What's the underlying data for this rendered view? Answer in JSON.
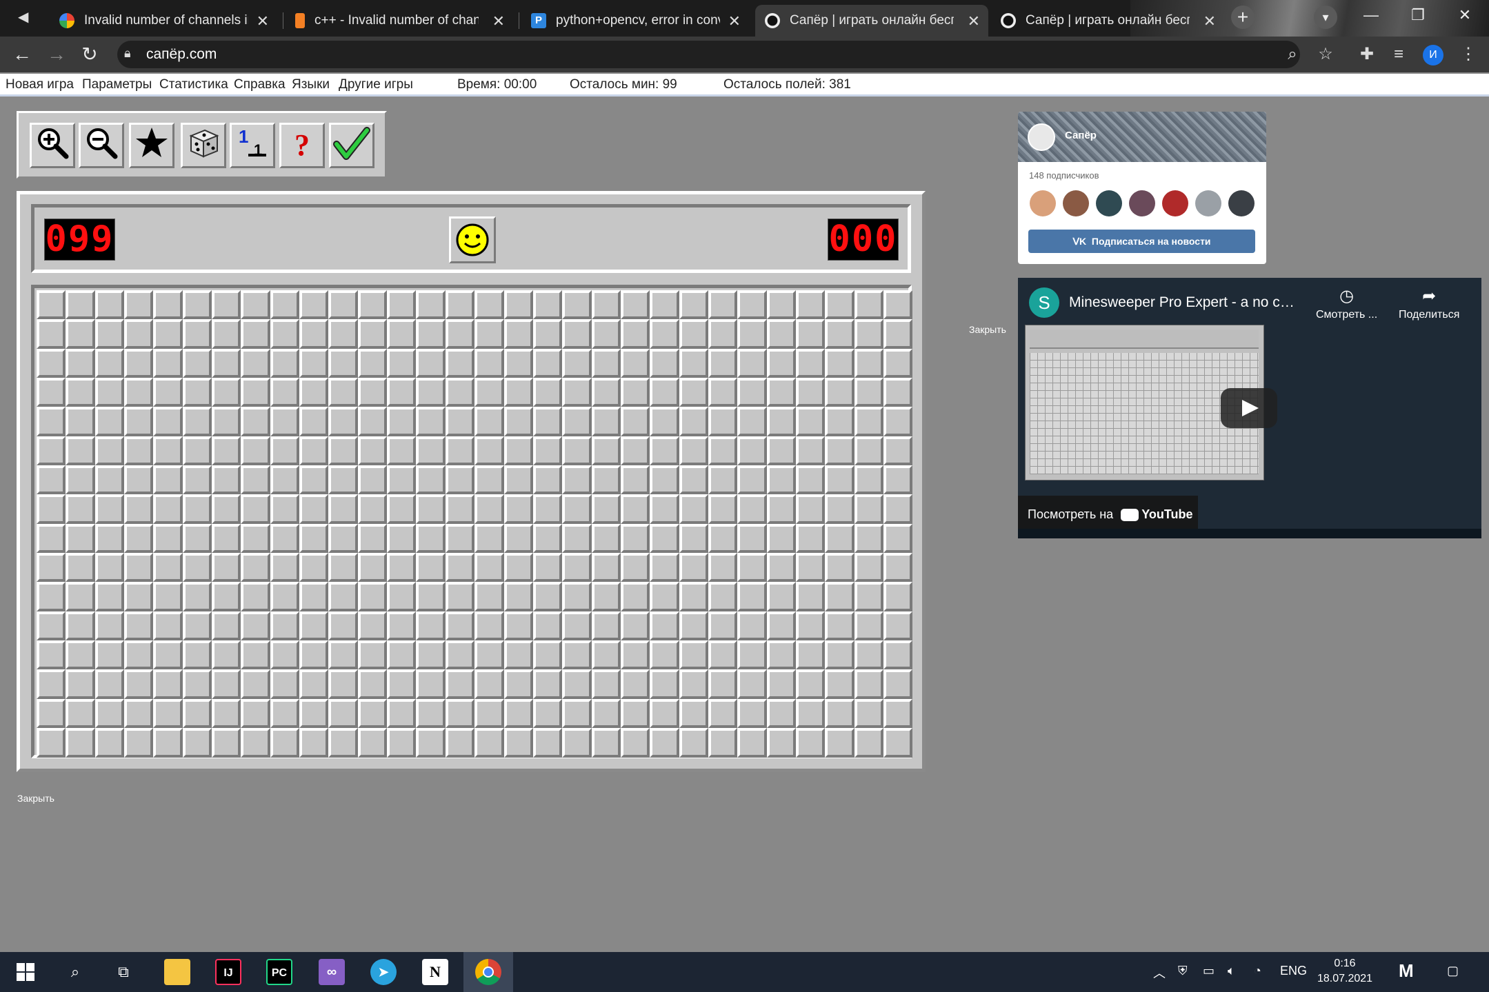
{
  "browser": {
    "tabs": [
      {
        "title": "Invalid number of channels in i"
      },
      {
        "title": "c++ - Invalid number of chann"
      },
      {
        "title": "python+opencv, error in conve"
      },
      {
        "title": "Сапёр | играть онлайн беспла"
      },
      {
        "title": "Сапёр | играть онлайн беспла"
      }
    ],
    "url": "сапёр.com",
    "profile_initial": "И"
  },
  "menu": {
    "items": [
      "Новая игра",
      "Параметры",
      "Статистика",
      "Справка",
      "Языки",
      "Другие игры"
    ],
    "time": "Время: 00:00",
    "mines_left": "Осталось мин: 99",
    "fields_left": "Осталось полей: 381"
  },
  "game": {
    "tool_icons": [
      "zoom-in-icon",
      "zoom-out-icon",
      "star-icon",
      "dice-icon",
      "numbers-flag-icon",
      "question-icon",
      "checkmark-icon"
    ],
    "mine_counter": "099",
    "timer": "000",
    "columns": 30,
    "rows": 16,
    "close_label": "Закрыть"
  },
  "vk_widget": {
    "name": "Сапёр",
    "subscribers": "148 подписчиков",
    "button": "Подписаться на новости",
    "close_label": "Закрыть"
  },
  "youtube": {
    "channel_initial": "S",
    "title": "Minesweeper Pro Expert - a no co...",
    "watch_later": "Смотреть ...",
    "share": "Поделиться",
    "watch_on": "Посмотреть на",
    "brand": "YouTube"
  },
  "taskbar": {
    "language": "ENG",
    "time": "0:16",
    "date": "18.07.2021"
  },
  "colors": {
    "page_bg": "#888888",
    "board_gray": "#c6c6c6",
    "counter_red": "#ff1010",
    "vk_blue": "#4a76a8"
  }
}
